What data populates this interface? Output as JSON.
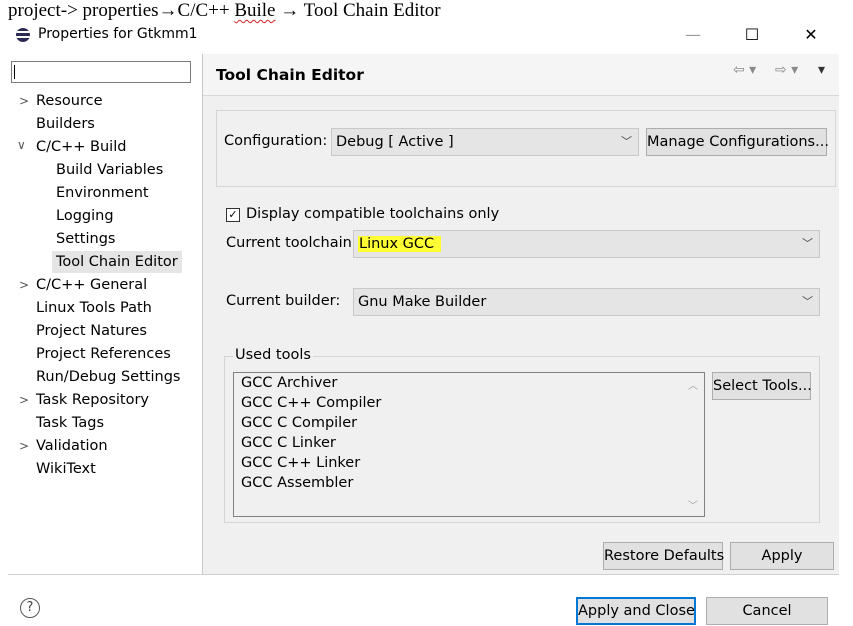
{
  "caption": {
    "part1": "project-> properties",
    "arrow1": "→",
    "part2": "C/C++ ",
    "part3": "Buile",
    "arrow2": " → ",
    "part4": "Tool Chain Editor"
  },
  "window": {
    "title": "Properties for Gtkmm1",
    "minimize": "—",
    "maximize": "☐",
    "close": "✕"
  },
  "filter": {
    "value": ""
  },
  "tree": {
    "resource": "Resource",
    "builders": "Builders",
    "cpp_build": "C/C++ Build",
    "build_variables": "Build Variables",
    "environment": "Environment",
    "logging": "Logging",
    "settings": "Settings",
    "tool_chain_editor": "Tool Chain Editor",
    "cpp_general": "C/C++ General",
    "linux_tools_path": "Linux Tools Path",
    "project_natures": "Project Natures",
    "project_references": "Project References",
    "run_debug_settings": "Run/Debug Settings",
    "task_repository": "Task Repository",
    "task_tags": "Task Tags",
    "validation": "Validation",
    "wikitext": "WikiText"
  },
  "page": {
    "title": "Tool Chain Editor",
    "nav_back": "⇦ ▾",
    "nav_forward": "⇨ ▾",
    "nav_menu": "▾"
  },
  "configuration": {
    "label": "Configuration:",
    "value": "Debug  [ Active ]",
    "manage_button": "Manage Configurations..."
  },
  "display_compatible": {
    "label": "Display compatible toolchains only",
    "checked": true,
    "mark": "✓"
  },
  "current_toolchain": {
    "label": "Current toolchain:",
    "value": "Linux GCC"
  },
  "current_builder": {
    "label": "Current builder:",
    "value": "Gnu Make Builder"
  },
  "used_tools": {
    "label": "Used tools",
    "items": [
      "GCC Archiver",
      "GCC C++ Compiler",
      "GCC C Compiler",
      "GCC C Linker",
      "GCC C++ Linker",
      "GCC Assembler"
    ],
    "select_button": "Select Tools..."
  },
  "buttons": {
    "restore_defaults": "Restore Defaults",
    "apply": "Apply",
    "apply_and_close": "Apply and Close",
    "cancel": "Cancel",
    "help": "?"
  },
  "colors": {
    "highlight": "#ffff33",
    "panel": "#f0f0f0",
    "selection": "#e5e5e5",
    "focus_border": "#0078d7"
  }
}
